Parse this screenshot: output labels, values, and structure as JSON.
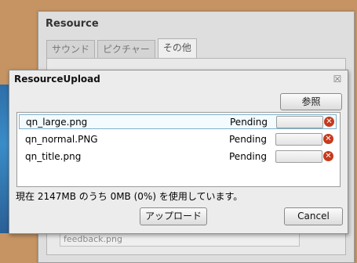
{
  "background_window": {
    "title": "Resource",
    "tabs": [
      "サウンド",
      "ピクチャー",
      "その他"
    ],
    "active_tab": 2,
    "visible_item": "feedback.png"
  },
  "dialog": {
    "title": "ResourceUpload",
    "close_symbol": "☒",
    "browse_label": "参照",
    "files": [
      {
        "name": "qn_large.png",
        "status": "Pending",
        "progress": 0
      },
      {
        "name": "qn_normal.PNG",
        "status": "Pending",
        "progress": 0
      },
      {
        "name": "qn_title.png",
        "status": "Pending",
        "progress": 0
      }
    ],
    "usage_text": "現在 2147MB のうち  0MB (0%) を使用しています。",
    "upload_label": "アップロード",
    "cancel_label": "Cancel"
  },
  "colors": {
    "desktop": "#c69463",
    "remove_icon": "#c53a1d",
    "selection_border": "#7fb2c9"
  },
  "icons": {
    "remove": "remove-icon",
    "close": "close-icon"
  }
}
